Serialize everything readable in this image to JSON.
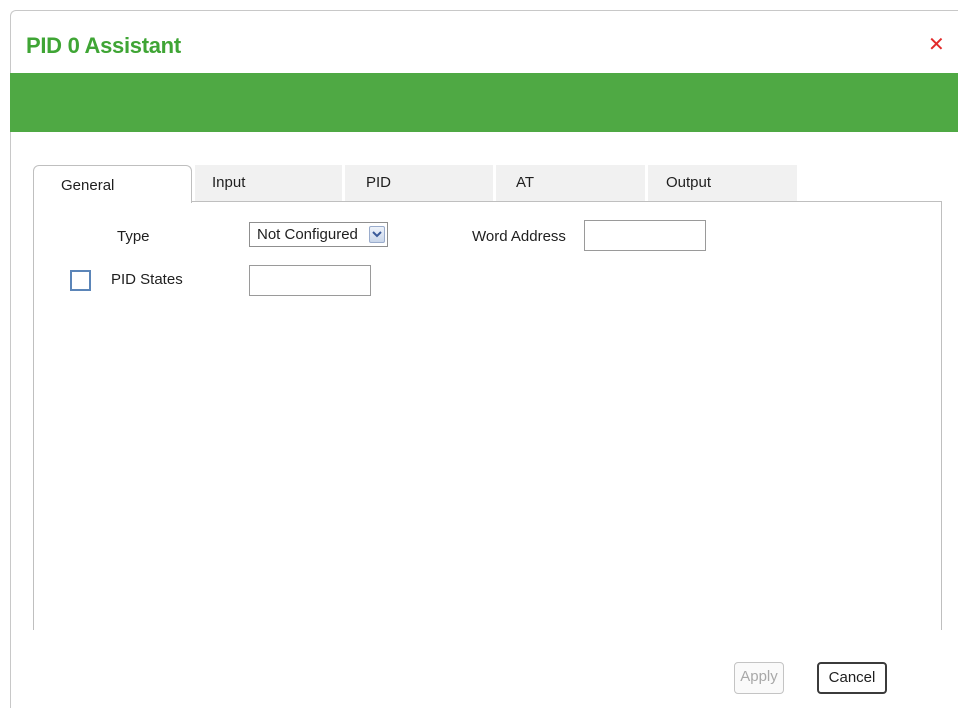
{
  "dialog": {
    "title": "PID 0 Assistant",
    "close_icon": "close-icon",
    "banner_color": "#4fa944",
    "title_color": "#3fa535"
  },
  "tabs": [
    {
      "label": "General",
      "active": true
    },
    {
      "label": "Input",
      "active": false
    },
    {
      "label": "PID",
      "active": false
    },
    {
      "label": "AT",
      "active": false
    },
    {
      "label": "Output",
      "active": false
    }
  ],
  "general": {
    "type_label": "Type",
    "type_value": "Not Configured",
    "word_address_label": "Word Address",
    "word_address_value": "",
    "pid_states_label": "PID States",
    "pid_states_checked": false,
    "pid_states_value": ""
  },
  "footer": {
    "apply_label": "Apply",
    "apply_enabled": false,
    "cancel_label": "Cancel"
  }
}
